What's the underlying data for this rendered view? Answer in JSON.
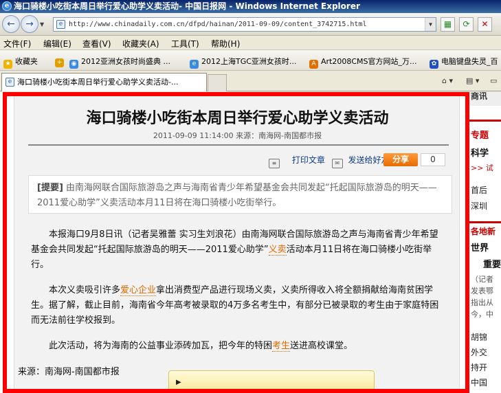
{
  "window": {
    "title": "海口骑楼小吃街本周日举行爱心助学义卖活动- 中国日报网 - Windows Internet Explorer"
  },
  "navigation": {
    "back_glyph": "←",
    "forward_glyph": "→",
    "address": "http://www.chinadaily.com.cn/dfpd/hainan/2011-09-09/content_3742715.html"
  },
  "menu": {
    "items": [
      "文件(F)",
      "编辑(E)",
      "查看(V)",
      "收藏夹(A)",
      "工具(T)",
      "帮助(H)"
    ]
  },
  "favorites": {
    "label": "收藏夹",
    "items": [
      "2012亚洲女孩时尚盛典 ...",
      "2012上海TGC亚洲女孩时...",
      "Art2008CMS官方网站_万...",
      "电脑键盘失灵_百"
    ]
  },
  "tab": {
    "label": "海口骑楼小吃街本周日举行爱心助学义卖活动-..."
  },
  "article": {
    "title": "海口骑楼小吃街本周日举行爱心助学义卖活动",
    "meta": "2011-09-09 11:14:00 来源：南海网-南国都市报",
    "print_label": "打印文章",
    "send_label": "发送给好友",
    "share_label": "分享",
    "share_count": "0",
    "summary_label": "[提要]",
    "summary_text": "由南海网联合国际旅游岛之声与海南省青少年希望基金会共同发起“托起国际旅游岛的明天——2011爱心助学”义卖活动本月11日将在海口骑楼小吃街举行。",
    "p1_pre": "本报海口9月8日讯（记者吴雅蕾 实习生刘浪花）由南海网联合国际旅游岛之声与海南省青少年希望基金会共同发起“托起国际旅游岛的明天——2011爱心助学”",
    "p1_kw": "义卖",
    "p1_post": "活动本月11日将在海口骑楼小吃街举行。",
    "p2_pre": "本次义卖吸引许多",
    "p2_kw": "爱心企业",
    "p2_post": "拿出消费型产品进行现场义卖，义卖所得收入将全额捐献给海南贫困学生。据了解，截止目前，海南省今年高考被录取的4万多名考生中，有部分已被录取的考生由于家庭特困而无法前往学校报到。",
    "p3_pre": "此次活动，将为海南的公益事业添砖加瓦，把今年的特困",
    "p3_kw": "考生",
    "p3_post": "送进高校课堂。",
    "source": "来源：南海网-南国都市报"
  },
  "sidebar": {
    "top": "商讯",
    "special": "专题",
    "science": "科学",
    "arrows": ">> 试",
    "home": "首后",
    "shenzhen": "深圳",
    "news_head": "各地新",
    "world": "世界",
    "important": "重要",
    "reporter": "（记者",
    "release": "发表鄂",
    "point": "指出从",
    "today": "今，中",
    "hu": "胡锦",
    "diplomacy": "外交",
    "hold": "持开",
    "china": "中国"
  }
}
